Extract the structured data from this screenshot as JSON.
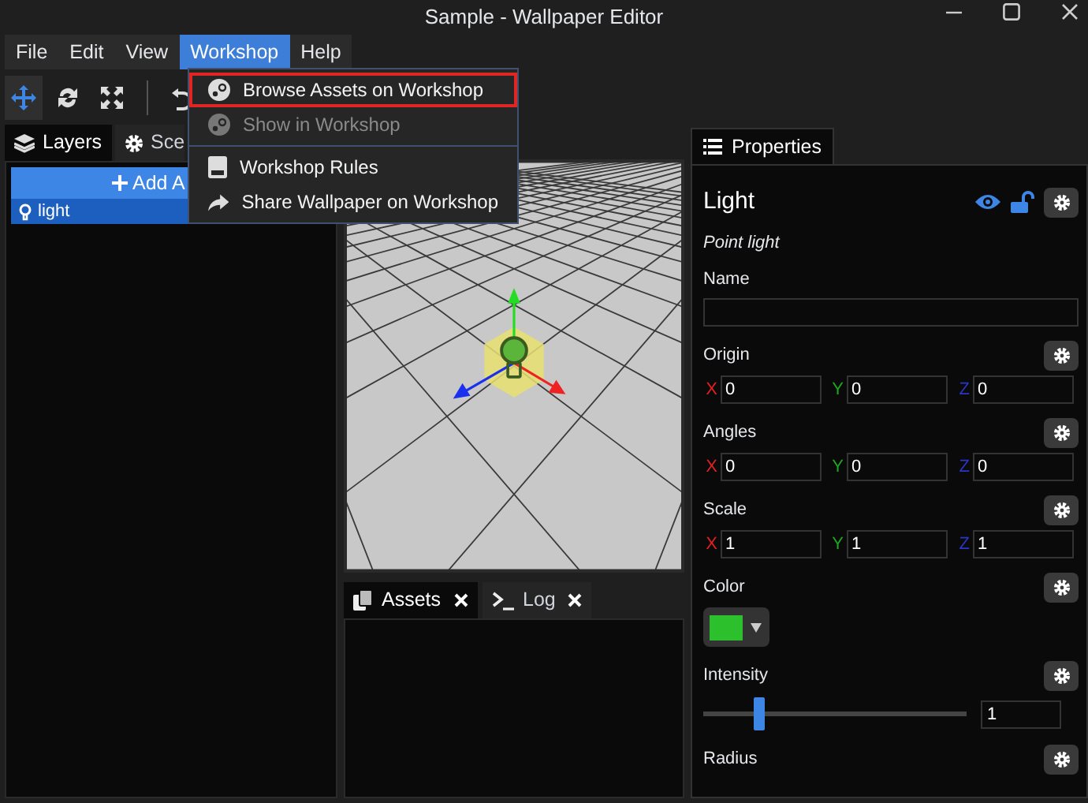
{
  "window": {
    "title": "Sample - Wallpaper Editor"
  },
  "menu_bar": [
    {
      "label": "File",
      "selected": false
    },
    {
      "label": "Edit",
      "selected": false
    },
    {
      "label": "View",
      "selected": false
    },
    {
      "label": "Workshop",
      "selected": true
    },
    {
      "label": "Help",
      "selected": false
    }
  ],
  "workshop_menu": {
    "groups": [
      [
        {
          "label": "Browse Assets on Workshop",
          "highlighted": true,
          "disabled": false
        },
        {
          "label": "Show in Workshop",
          "highlighted": false,
          "disabled": true
        }
      ],
      [
        {
          "label": "Workshop Rules",
          "highlighted": false,
          "disabled": false
        },
        {
          "label": "Share Wallpaper on Workshop",
          "highlighted": false,
          "disabled": false
        }
      ]
    ]
  },
  "toolbar": [
    {
      "selected": true
    },
    {
      "selected": false
    },
    {
      "selected": false
    },
    {
      "selected": false
    }
  ],
  "left_panel": {
    "tabs": [
      {
        "label": "Layers",
        "selected": true
      },
      {
        "label": "Sce",
        "selected": false
      }
    ],
    "add_button": "Add A",
    "layers": [
      {
        "label": "light",
        "selected": true
      }
    ]
  },
  "bottom_panel": {
    "tabs": [
      {
        "label": "Assets",
        "selected": true
      },
      {
        "label": "Log",
        "selected": false
      }
    ]
  },
  "properties": {
    "tab": "Properties",
    "title": "Light",
    "subtitle": "Point light",
    "visible": true,
    "locked": false,
    "fields": [
      {
        "kind": "text",
        "label": "Name",
        "options_button": false
      },
      {
        "kind": "vector",
        "label": "Origin",
        "options_button": true,
        "axes": [
          "X",
          "Y",
          "Z"
        ],
        "values": [
          "0",
          "0",
          "0"
        ]
      },
      {
        "kind": "vector",
        "label": "Angles",
        "options_button": true,
        "axes": [
          "X",
          "Y",
          "Z"
        ],
        "values": [
          "0",
          "0",
          "0"
        ]
      },
      {
        "kind": "vector",
        "label": "Scale",
        "options_button": true,
        "axes": [
          "X",
          "Y",
          "Z"
        ],
        "values": [
          "1",
          "1",
          "1"
        ]
      },
      {
        "kind": "color",
        "label": "Color",
        "options_button": true,
        "color": "#2cc12c"
      },
      {
        "kind": "slider",
        "label": "Intensity",
        "options_button": true,
        "level": 0.21,
        "value": "1"
      },
      {
        "kind": "header",
        "label": "Radius",
        "options_button": true
      }
    ]
  }
}
